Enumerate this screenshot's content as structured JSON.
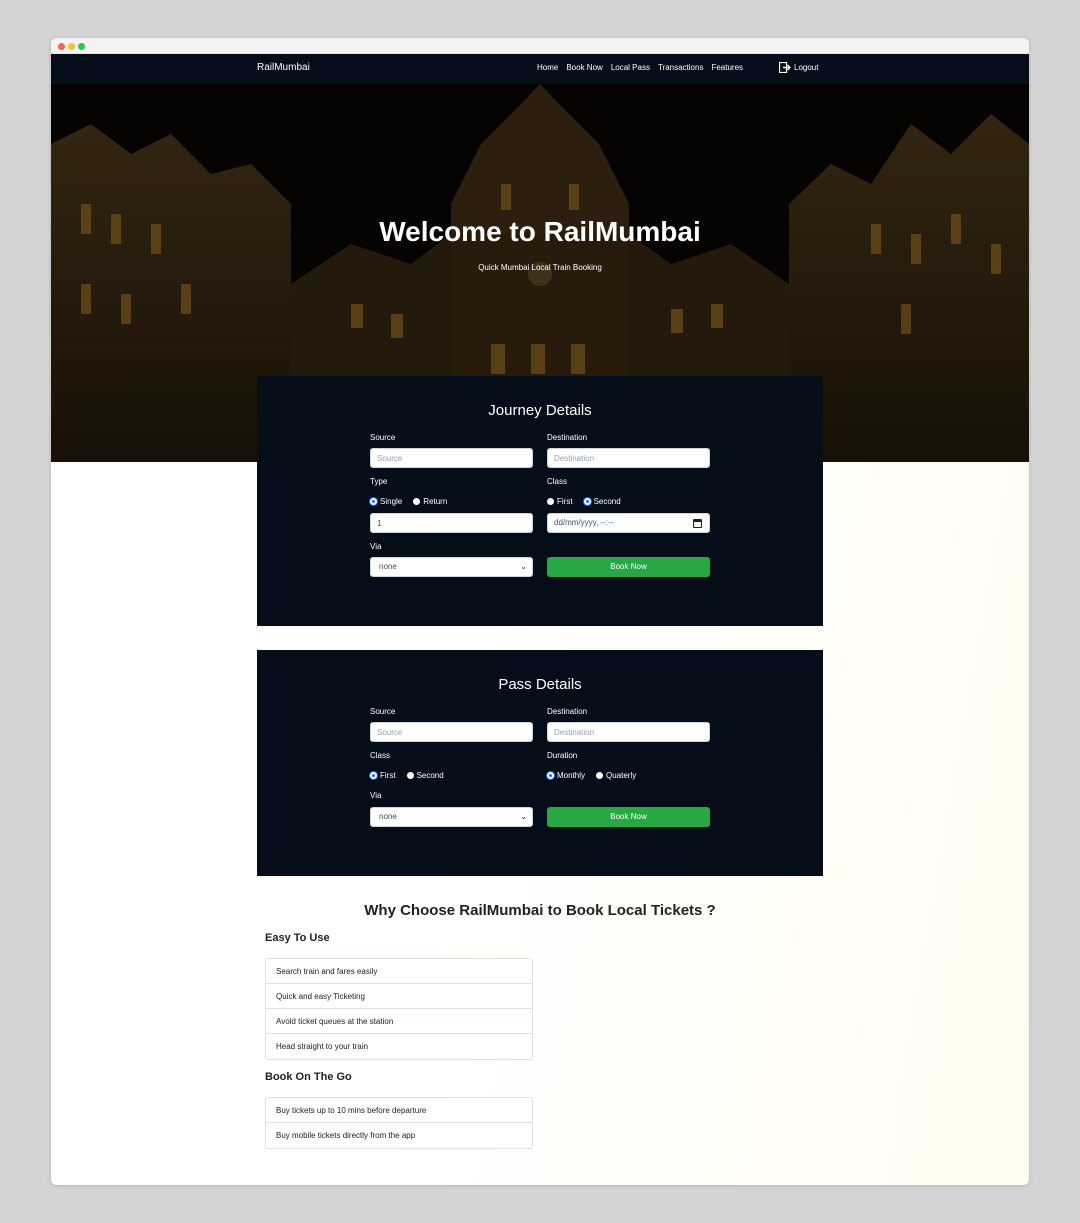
{
  "nav": {
    "brand": "RailMumbai",
    "links": [
      "Home",
      "Book Now",
      "Local Pass",
      "Transactions",
      "Features"
    ],
    "logout": "Logout"
  },
  "hero": {
    "title": "Welcome to RailMumbai",
    "subtitle": "Quick Mumbai Local Train Booking"
  },
  "journey": {
    "title": "Journey Details",
    "source_label": "Source",
    "source_placeholder": "Source",
    "destination_label": "Destination",
    "destination_placeholder": "Destination",
    "type_label": "Type",
    "type_options": [
      "Single",
      "Return"
    ],
    "type_selected": "Single",
    "class_label": "Class",
    "class_options": [
      "First",
      "Second"
    ],
    "class_selected": "Second",
    "quantity_value": "1",
    "date_placeholder": "dd/mm/yyyy, --:--",
    "via_label": "Via",
    "via_value": "none",
    "book_button": "Book Now"
  },
  "pass": {
    "title": "Pass Details",
    "source_label": "Source",
    "source_placeholder": "Source",
    "destination_label": "Destination",
    "destination_placeholder": "Destination",
    "class_label": "Class",
    "class_options": [
      "First",
      "Second"
    ],
    "class_selected": "First",
    "duration_label": "Duration",
    "duration_options": [
      "Monthly",
      "Quaterly"
    ],
    "duration_selected": "Monthly",
    "via_label": "Via",
    "via_value": "none",
    "book_button": "Book Now"
  },
  "why": {
    "title": "Why Choose RailMumbai to Book Local Tickets ?",
    "easy_title": "Easy To Use",
    "easy_items": [
      "Search train and fares easily",
      "Quick and easy Ticketing",
      "Avoid ticket queues at the station",
      "Head straight to your train"
    ],
    "go_title": "Book On The Go",
    "go_items": [
      "Buy tickets up to 10 mins before departure",
      "Buy mobile tickets directly from the app"
    ]
  }
}
